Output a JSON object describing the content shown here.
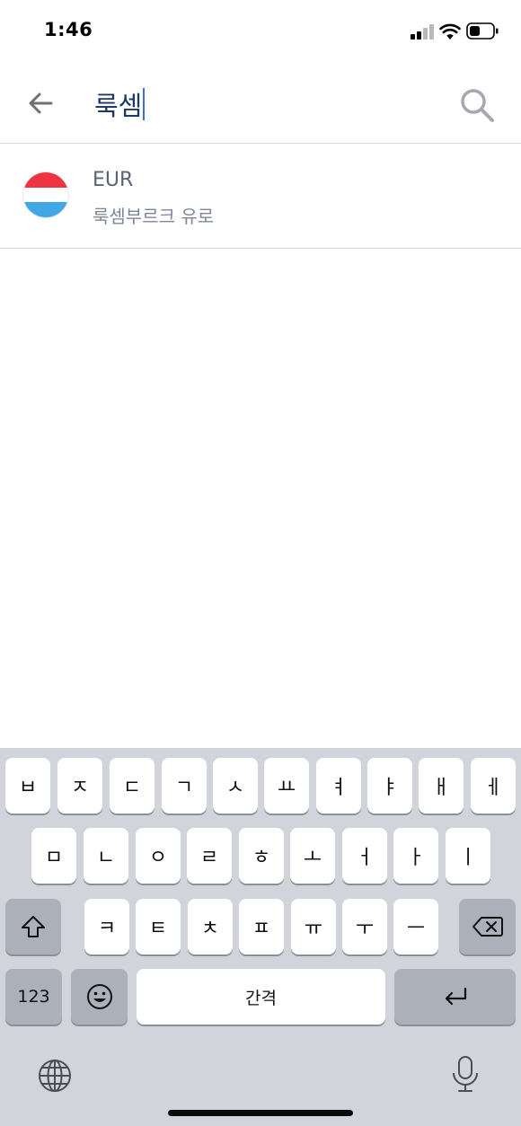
{
  "status": {
    "time": "1:46"
  },
  "search": {
    "query": "룩셈"
  },
  "results": [
    {
      "code": "EUR",
      "name": "룩셈부르크 유로",
      "flag_colors": [
        "#ef3340",
        "#ffffff",
        "#41a8e8"
      ]
    }
  ],
  "keyboard": {
    "row1": [
      "ㅂ",
      "ㅈ",
      "ㄷ",
      "ㄱ",
      "ㅅ",
      "ㅛ",
      "ㅕ",
      "ㅑ",
      "ㅐ",
      "ㅔ"
    ],
    "row2": [
      "ㅁ",
      "ㄴ",
      "ㅇ",
      "ㄹ",
      "ㅎ",
      "ㅗ",
      "ㅓ",
      "ㅏ",
      "ㅣ"
    ],
    "row3": [
      "ㅋ",
      "ㅌ",
      "ㅊ",
      "ㅍ",
      "ㅠ",
      "ㅜ",
      "ㅡ"
    ],
    "numbers_label": "123",
    "space_label": "간격"
  },
  "colors": {
    "accent": "#3b6fd6",
    "keyboard_bg": "#d1d4da"
  }
}
